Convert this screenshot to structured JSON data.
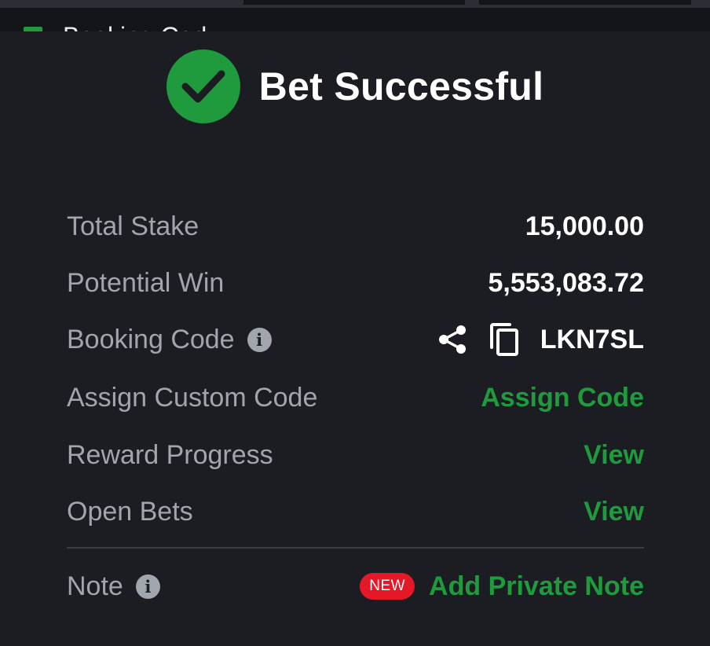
{
  "header": {
    "title": "Bet Successful",
    "status_icon": "check-circle-icon",
    "accent_color": "#1f9a3d"
  },
  "behind": {
    "partial_text": "Booking Cod"
  },
  "rows": {
    "total_stake": {
      "label": "Total Stake",
      "value": "15,000.00"
    },
    "potential_win": {
      "label": "Potential Win",
      "value": "5,553,083.72"
    },
    "booking_code": {
      "label": "Booking Code",
      "value": "LKN7SL",
      "info_icon": "info-icon",
      "share_icon": "share-icon",
      "copy_icon": "copy-icon"
    },
    "custom_code": {
      "label": "Assign Custom Code",
      "action": "Assign Code"
    },
    "reward_progress": {
      "label": "Reward Progress",
      "action": "View"
    },
    "open_bets": {
      "label": "Open Bets",
      "action": "View"
    },
    "note": {
      "label": "Note",
      "badge": "NEW",
      "action": "Add Private Note",
      "info_icon": "info-icon"
    }
  }
}
